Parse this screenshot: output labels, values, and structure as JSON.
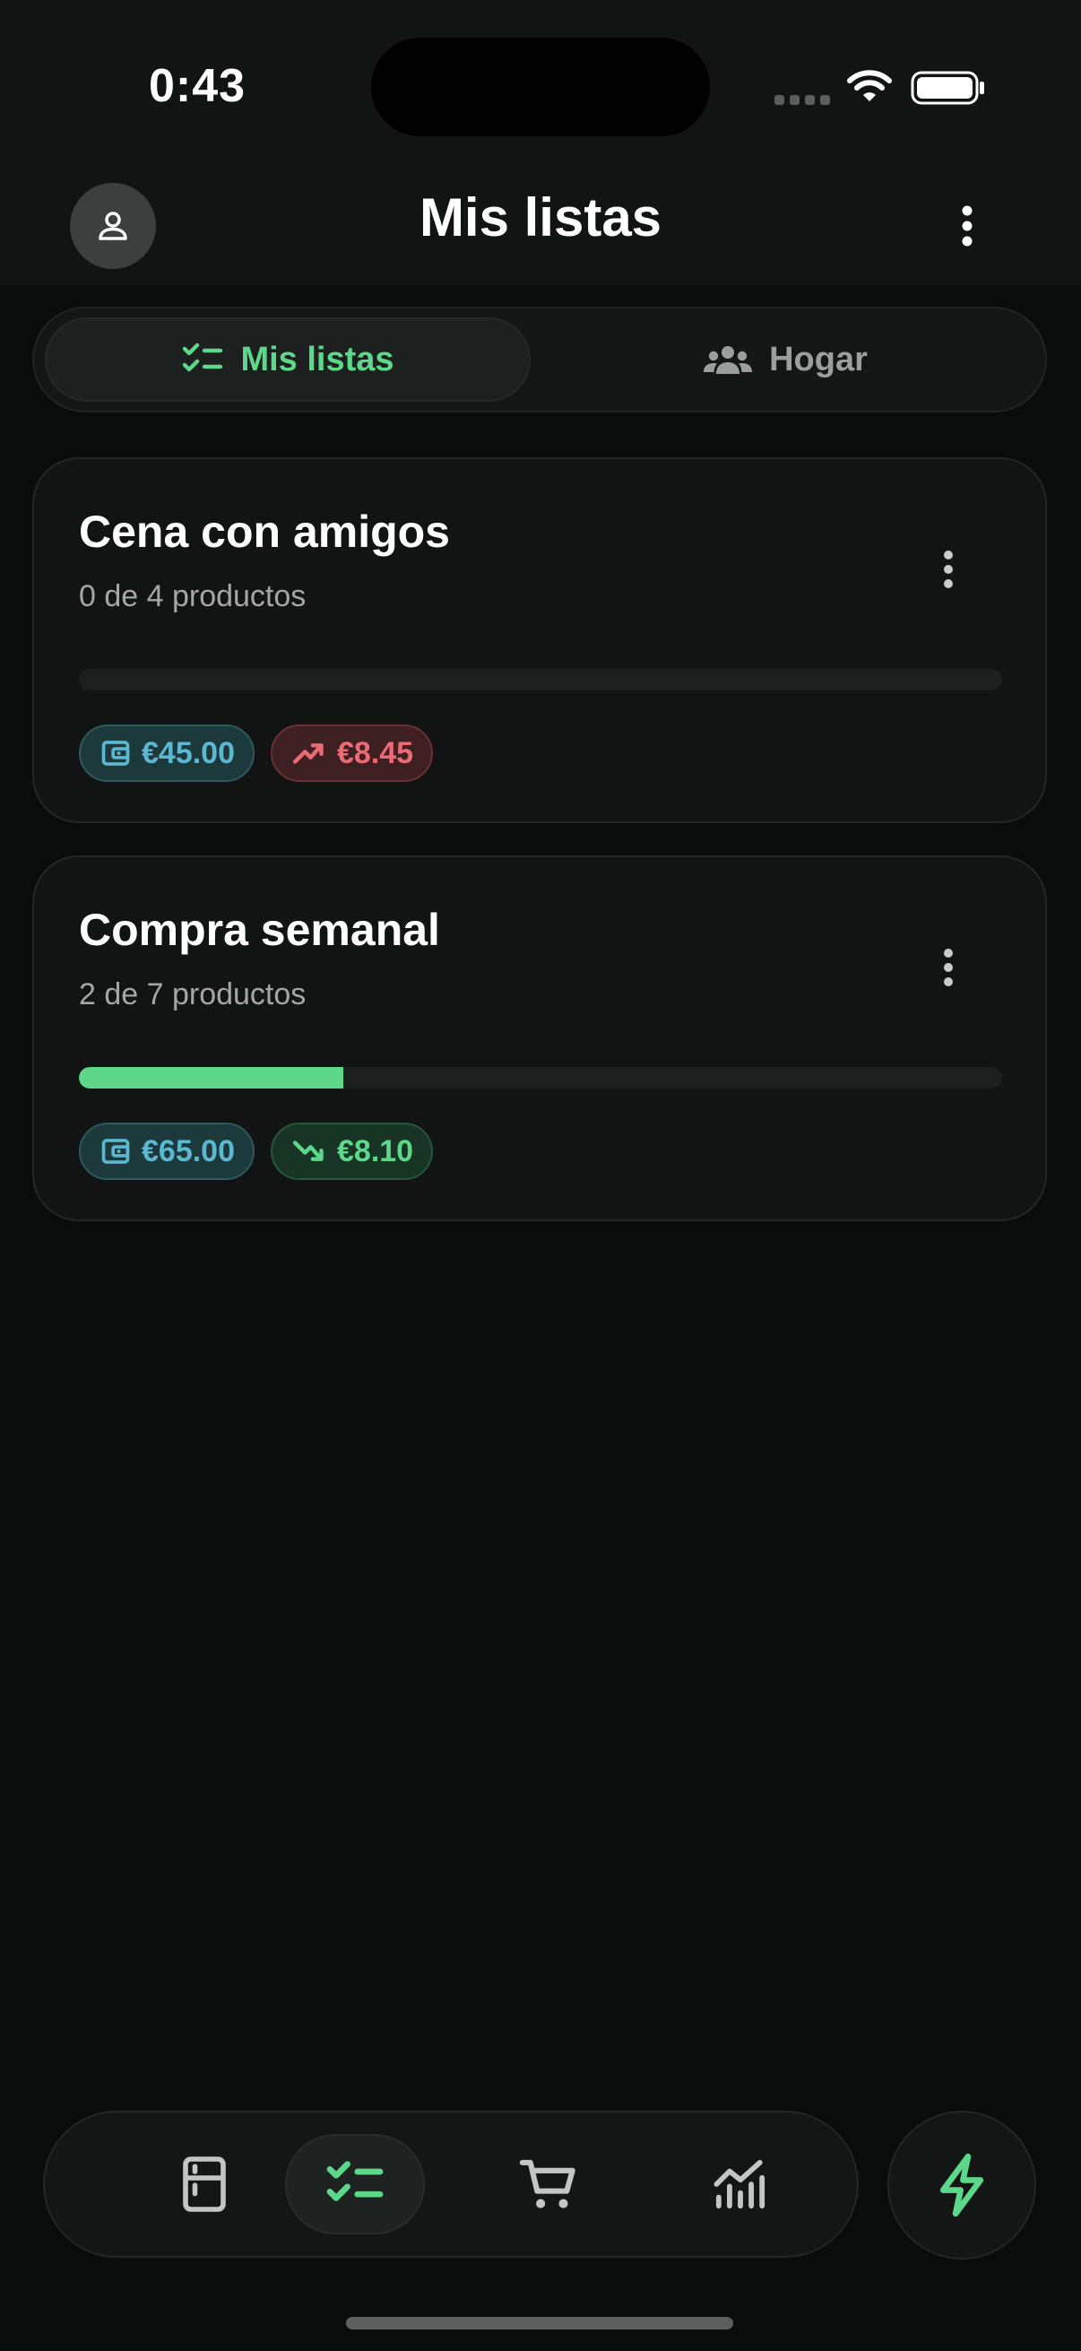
{
  "status_bar": {
    "time": "0:43"
  },
  "header": {
    "title": "Mis listas",
    "avatar_icon": "user-icon",
    "menu_icon": "more-vertical-icon"
  },
  "segmented": {
    "tabs": [
      {
        "label": "Mis listas",
        "icon": "checklist-icon",
        "active": true
      },
      {
        "label": "Hogar",
        "icon": "group-icon",
        "active": false
      }
    ]
  },
  "lists": [
    {
      "title": "Cena con amigos",
      "subtitle": "0 de 4 productos",
      "progress": 0,
      "budget": "€45.00",
      "diff": "€8.45",
      "diff_trend": "up"
    },
    {
      "title": "Compra semanal",
      "subtitle": "2 de 7 productos",
      "progress": 0.286,
      "budget": "€65.00",
      "diff": "€8.10",
      "diff_trend": "down"
    }
  ],
  "bottom_nav": {
    "items": [
      {
        "name": "pantry",
        "icon": "fridge-icon",
        "active": false
      },
      {
        "name": "lists",
        "icon": "checklist-icon",
        "active": true
      },
      {
        "name": "cart",
        "icon": "cart-icon",
        "active": false
      },
      {
        "name": "stats",
        "icon": "chart-icon",
        "active": false
      }
    ],
    "fab_icon": "lightning-icon"
  },
  "colors": {
    "accent": "#5dd88a",
    "budget": "#5cb7d0",
    "increase": "#ea6b74",
    "background": "#0a0c0b"
  }
}
